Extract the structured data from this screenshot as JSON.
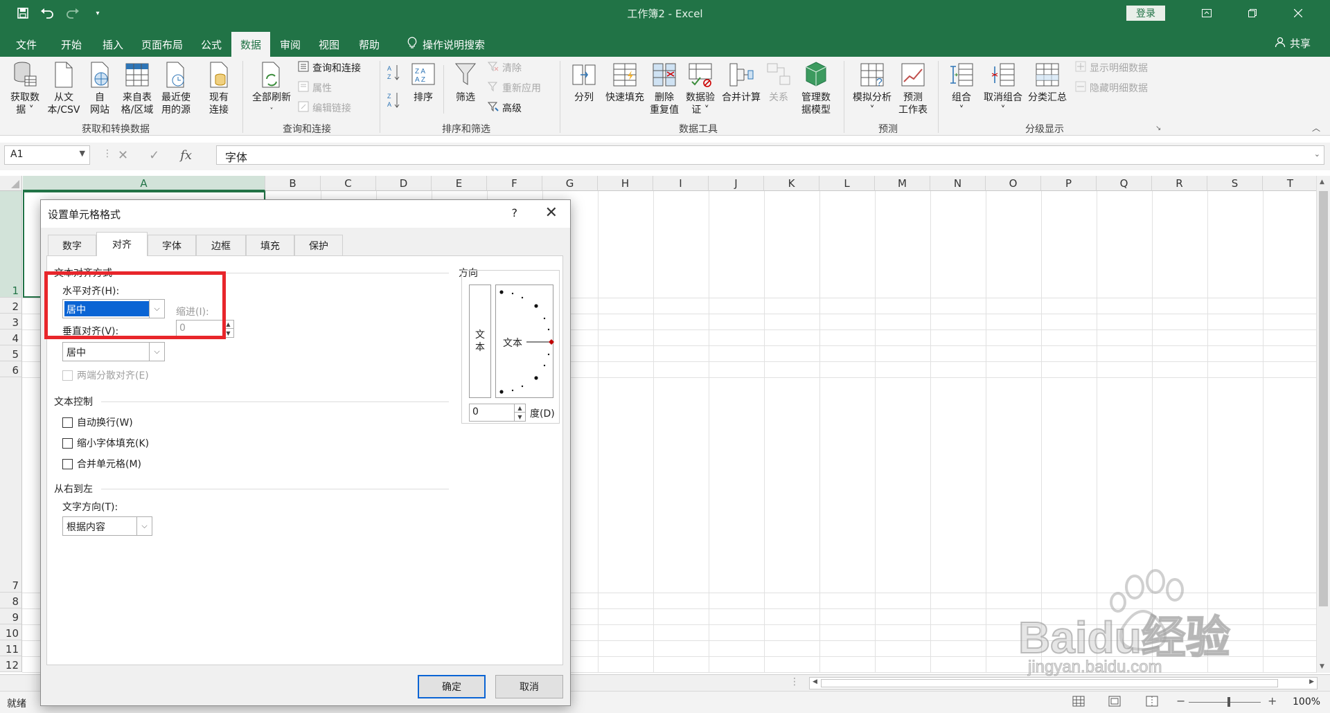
{
  "window": {
    "title": "工作簿2  -  Excel",
    "login": "登录"
  },
  "ribbon_tabs": [
    "文件",
    "开始",
    "插入",
    "页面布局",
    "公式",
    "数据",
    "审阅",
    "视图",
    "帮助",
    "操作说明搜索"
  ],
  "active_tab": "数据",
  "share": "共享",
  "groups": {
    "get_transform": {
      "label": "获取和转换数据",
      "buttons": [
        "获取数\n据 ˅",
        "从文\n本/CSV",
        "自\n网站",
        "来自表\n格/区域",
        "最近使\n用的源",
        "现有\n连接"
      ]
    },
    "queries": {
      "label": "查询和连接",
      "refresh": "全部刷新",
      "items": [
        "查询和连接",
        "属性",
        "编辑链接"
      ]
    },
    "sort_filter": {
      "label": "排序和筛选",
      "sort": "排序",
      "filter": "筛选",
      "items": [
        "清除",
        "重新应用",
        "高级"
      ]
    },
    "data_tools": {
      "label": "数据工具",
      "buttons": [
        "分列",
        "快速填充",
        "删除\n重复值",
        "数据验\n证 ˅",
        "合并计算",
        "关系",
        "管理数\n据模型"
      ]
    },
    "forecast": {
      "label": "预测",
      "buttons": [
        "模拟分析\n˅",
        "预测\n工作表"
      ]
    },
    "outline": {
      "label": "分级显示",
      "buttons": [
        "组合\n˅",
        "取消组合\n˅",
        "分类汇总"
      ],
      "items": [
        "显示明细数据",
        "隐藏明细数据"
      ]
    }
  },
  "formula_bar": {
    "name_box": "A1",
    "formula": "字体"
  },
  "columns": [
    "A",
    "B",
    "C",
    "D",
    "E",
    "F",
    "G",
    "H",
    "I",
    "J",
    "K",
    "L",
    "M",
    "N",
    "O",
    "P",
    "Q",
    "R",
    "S",
    "T"
  ],
  "rows": [
    "1",
    "2",
    "3",
    "4",
    "5",
    "6",
    "7",
    "8",
    "9",
    "10",
    "11",
    "12"
  ],
  "status": {
    "ready": "就绪",
    "zoom": "100%"
  },
  "dialog": {
    "title": "设置单元格格式",
    "help": "?",
    "tabs": [
      "数字",
      "对齐",
      "字体",
      "边框",
      "填充",
      "保护"
    ],
    "active_tab": "对齐",
    "text_alignment": {
      "section": "文本对齐方式",
      "horizontal_label": "水平对齐(H):",
      "horizontal_value": "居中",
      "indent_label": "缩进(I):",
      "indent_value": "0",
      "vertical_label": "垂直对齐(V):",
      "vertical_value": "居中",
      "justify_distributed": "两端分散对齐(E)"
    },
    "text_control": {
      "section": "文本控制",
      "wrap": "自动换行(W)",
      "shrink": "缩小字体填充(K)",
      "merge": "合并单元格(M)"
    },
    "rtl": {
      "section": "从右到左",
      "direction_label": "文字方向(T):",
      "direction_value": "根据内容"
    },
    "orientation": {
      "section": "方向",
      "vertical_text": "文\n本",
      "text": "文本",
      "degree_value": "0",
      "degree_label": "度(D)"
    },
    "ok": "确定",
    "cancel": "取消"
  },
  "watermark": {
    "brand": "Bai",
    "brand2": "du",
    "cn": "经验",
    "url": "jingyan.baidu.com"
  }
}
